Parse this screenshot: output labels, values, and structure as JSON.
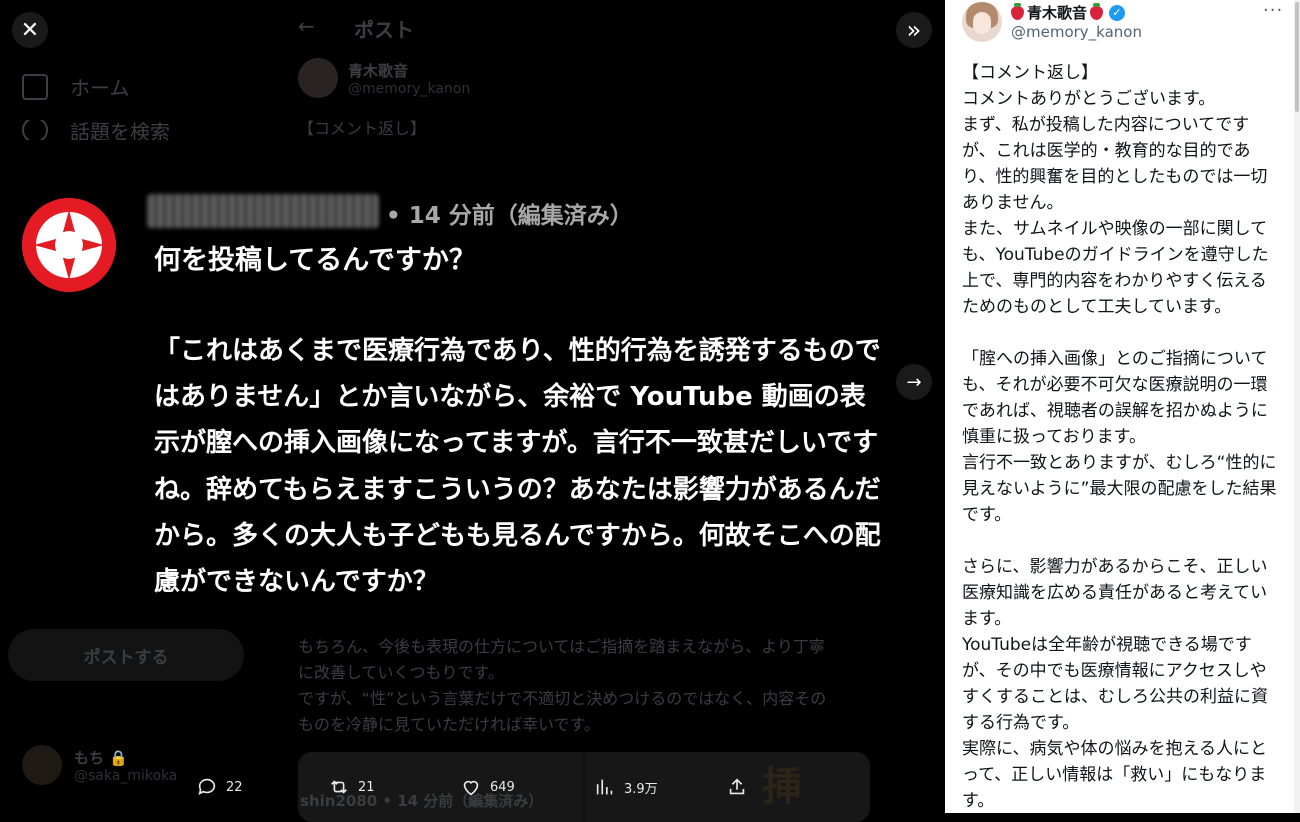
{
  "background": {
    "nav_home": "ホーム",
    "nav_explore": "話題を検索",
    "post_button": "ポストする",
    "header_title": "ポスト",
    "author_name": "青木歌音",
    "author_handle": "@memory_kanon",
    "post_first_line": "【コメント返し】",
    "post_tail": [
      "もちろん、今後も表現の仕方についてはご指摘を踏まえながら、より丁寧",
      "に改善していくつもりです。",
      "ですが、“性”という言葉だけで不適切と決めつけるのではなく、内容その",
      "ものを冷静に見ていただければ幸いです。"
    ],
    "media_caption": "shin2080 • 14 分前（編集済み）",
    "media_kanji": "挿",
    "user_name": "もち",
    "user_handle": "@saka_mikoka"
  },
  "viewer": {
    "meta": "• 14 分前（編集済み）",
    "question_title": "何を投稿してるんですか？",
    "question_lines": [
      "「これはあくまで医療行為であり、性的行為を誘発するもので",
      "はありません」とか言いながら、余裕で YouTube 動画の表",
      "示が膣への挿入画像になってますが。言行不一致甚だしいです",
      "ね。辞めてもらえますこういうの？あなたは影響力があるんだ",
      "から。多くの大人も子どもも見るんですから。何故そこへの配",
      "慮ができないんですか？"
    ]
  },
  "actions": {
    "replies": "22",
    "reposts": "21",
    "likes": "649",
    "views": "3.9万"
  },
  "panel": {
    "name": "青木歌音",
    "handle": "@memory_kanon",
    "more": "···",
    "body_lines": [
      "【コメント返し】",
      "コメントありがとうございます。",
      "まず、私が投稿した内容についてです",
      "が、これは医学的・教育的な目的であ",
      "り、性的興奮を目的としたものでは一切",
      "ありません。",
      "また、サムネイルや映像の一部に関して",
      "も、YouTubeのガイドラインを遵守した",
      "上で、専門的内容をわかりやすく伝える",
      "ためのものとして工夫しています。",
      "",
      "「腟への挿入画像」とのご指摘について",
      "も、それが必要不可欠な医療説明の一環",
      "であれば、視聴者の誤解を招かぬように",
      "慎重に扱っております。",
      "言行不一致とありますが、むしろ“性的に",
      "見えないように”最大限の配慮をした結果",
      "です。",
      "",
      "さらに、影響力があるからこそ、正しい",
      "医療知識を広める責任があると考えてい",
      "ます。",
      "YouTubeは全年齢が視聴できる場です",
      "が、その中でも医療情報にアクセスしや",
      "すくすることは、むしろ公共の利益に資",
      "する行為です。",
      "実際に、病気や体の悩みを抱える人にと",
      "って、正しい情報は「救い」にもなりま",
      "す。"
    ]
  },
  "colors": {
    "accent": "#1d9bf0",
    "logo_red": "#e41b23"
  }
}
